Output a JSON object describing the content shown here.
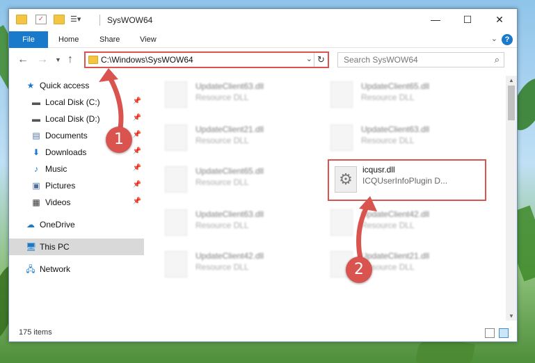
{
  "window": {
    "title": "SysWOW64"
  },
  "ribbon": {
    "tabs": [
      {
        "label": "File"
      },
      {
        "label": "Home"
      },
      {
        "label": "Share"
      },
      {
        "label": "View"
      }
    ],
    "help": "?"
  },
  "address": {
    "path": "C:\\Windows\\SysWOW64"
  },
  "search": {
    "placeholder": "Search SysWOW64"
  },
  "sidebar": {
    "items": [
      {
        "label": "Quick access",
        "icon": "star-icon"
      },
      {
        "label": "Local Disk (C:)",
        "icon": "drive-icon"
      },
      {
        "label": "Local Disk (D:)",
        "icon": "drive-icon"
      },
      {
        "label": "Documents",
        "icon": "documents-icon"
      },
      {
        "label": "Downloads",
        "icon": "download-icon"
      },
      {
        "label": "Music",
        "icon": "music-icon"
      },
      {
        "label": "Pictures",
        "icon": "pictures-icon"
      },
      {
        "label": "Videos",
        "icon": "videos-icon"
      },
      {
        "label": "OneDrive",
        "icon": "cloud-icon"
      },
      {
        "label": "This PC",
        "icon": "computer-icon"
      },
      {
        "label": "Network",
        "icon": "network-icon"
      }
    ]
  },
  "files": [
    {
      "name": "UpdateClient63.dll",
      "type": "Resource DLL"
    },
    {
      "name": "UpdateClient65.dll",
      "type": "Resource DLL"
    },
    {
      "name": "UpdateClient21.dll",
      "type": "Resource DLL"
    },
    {
      "name": "UpdateClient63.dll",
      "type": "Resource DLL"
    },
    {
      "name": "UpdateClient65.dll",
      "type": "Resource DLL"
    },
    {
      "name": "icqusr.dll",
      "type": "ICQUserInfoPlugin D..."
    },
    {
      "name": "UpdateClient63.dll",
      "type": "Resource DLL"
    },
    {
      "name": "UpdateClient42.dll",
      "type": "Resource DLL"
    },
    {
      "name": "UpdateClient42.dll",
      "type": "Resource DLL"
    },
    {
      "name": "UpdateClient21.dll",
      "type": "Resource DLL"
    }
  ],
  "status": {
    "items": "175 items"
  },
  "annotations": {
    "step1": "1",
    "step2": "2"
  },
  "colors": {
    "accent": "#1979ca",
    "annotation": "#d9534f"
  }
}
